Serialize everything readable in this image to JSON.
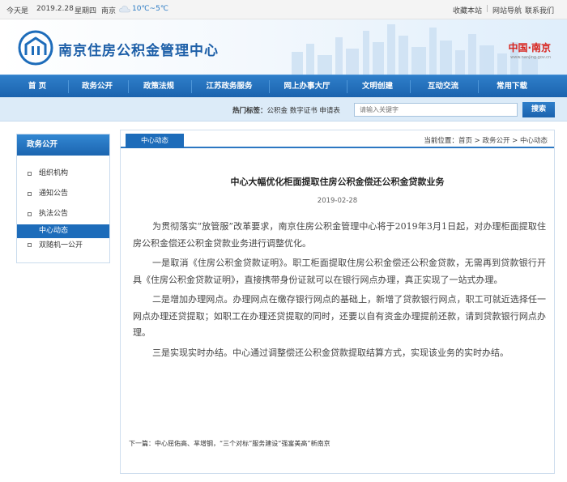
{
  "topbar": {
    "today_label": "今天是",
    "date": "2019.2.28",
    "weekday": "星期四",
    "city": "南京",
    "weather_icon": "cloud-icon",
    "temperature": "10℃~5℃",
    "links": [
      "收藏本站",
      "网站导航",
      "联系我们"
    ]
  },
  "header": {
    "site_title": "南京住房公积金管理中心",
    "brand_name": "中国·南京",
    "brand_url": "www.nanjing.gov.cn",
    "logo_icon": "house-emblem-icon"
  },
  "nav": {
    "items": [
      "首 页",
      "政务公开",
      "政策法规",
      "江苏政务服务",
      "网上办事大厅",
      "文明创建",
      "互动交流",
      "常用下载"
    ]
  },
  "search": {
    "hot_label": "热门标签：",
    "hot_tags": "公积金  数字证书  申请表",
    "placeholder": "请输入关键字",
    "button_label": "搜索"
  },
  "sidebar": {
    "title": "政务公开",
    "items": [
      "组织机构",
      "通知公告",
      "执法公告",
      "中心动态",
      "双随机一公开"
    ],
    "active_index": 3
  },
  "main": {
    "tab_label": "中心动态",
    "breadcrumb_label": "当前位置：",
    "breadcrumb": "首页 > 政务公开 > 中心动态",
    "title": "中心大幅优化柜面提取住房公积金偿还公积金贷款业务",
    "date": "2019-02-28",
    "paragraphs": [
      "为贯彻落实“放管服”改革要求，南京住房公积金管理中心将于2019年3月1日起，对办理柜面提取住房公积金偿还公积金贷款业务进行调整优化。",
      "一是取消《住房公积金贷款证明》。职工柜面提取住房公积金偿还公积金贷款，无需再到贷款银行开具《住房公积金贷款证明》，直接携带身份证就可以在银行网点办理，真正实现了一站式办理。",
      "二是增加办理网点。办理网点在缴存银行网点的基础上，新增了贷款银行网点，职工可就近选择任一网点办理还贷提取；如职工在办理还贷提取的同时，还要以自有资金办理提前还款，请到贷款银行网点办理。",
      "三是实现实时办结。中心通过调整偿还公积金贷款提取结算方式，实现该业务的实时办结。"
    ],
    "next_article": "下一篇：中心屈佑高、芈增钢，“三个对标”服务建设“强富美高”新南京"
  },
  "colors": {
    "primary_blue": "#1d6cba",
    "title_blue": "#1d5fa8",
    "brand_red": "#d8231d",
    "search_strip": "#dcebf8"
  }
}
